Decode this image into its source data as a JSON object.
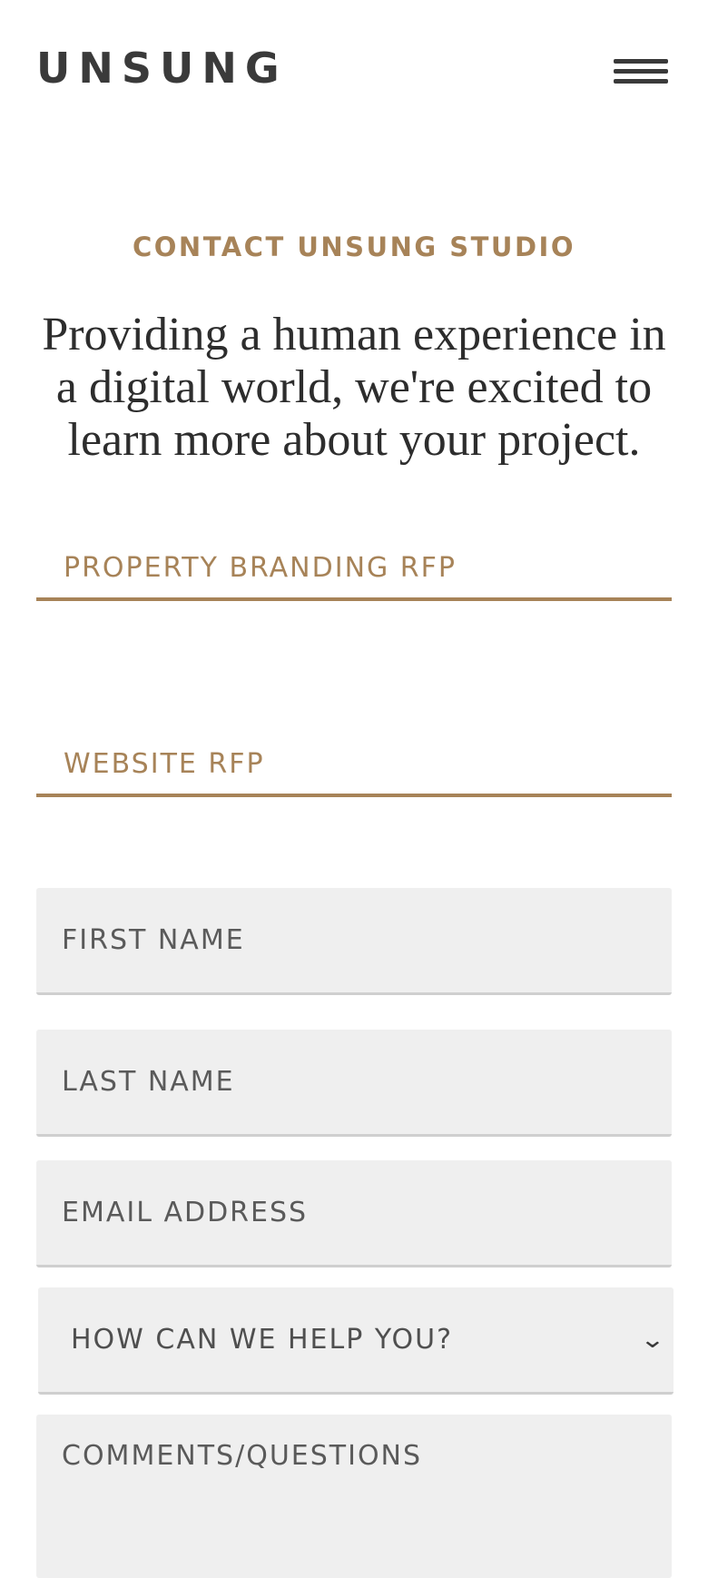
{
  "header": {
    "logo": "UNSUNG",
    "menu_icon": "hamburger-menu-icon"
  },
  "intro": {
    "eyebrow": "CONTACT UNSUNG STUDIO",
    "headline": "Providing a human experience in a digital world, we're excited to learn more about your project."
  },
  "rfp_links": [
    {
      "label": "PROPERTY BRANDING RFP"
    },
    {
      "label": "WEBSITE RFP"
    }
  ],
  "form": {
    "first_name_placeholder": "FIRST NAME",
    "last_name_placeholder": "LAST NAME",
    "email_placeholder": "EMAIL ADDRESS",
    "help_select_value": "HOW CAN WE HELP YOU?",
    "comments_placeholder": "COMMENTS/QUESTIONS"
  },
  "colors": {
    "accent": "#a78358",
    "text_dark": "#3a3a3a",
    "field_bg": "#efefef"
  }
}
